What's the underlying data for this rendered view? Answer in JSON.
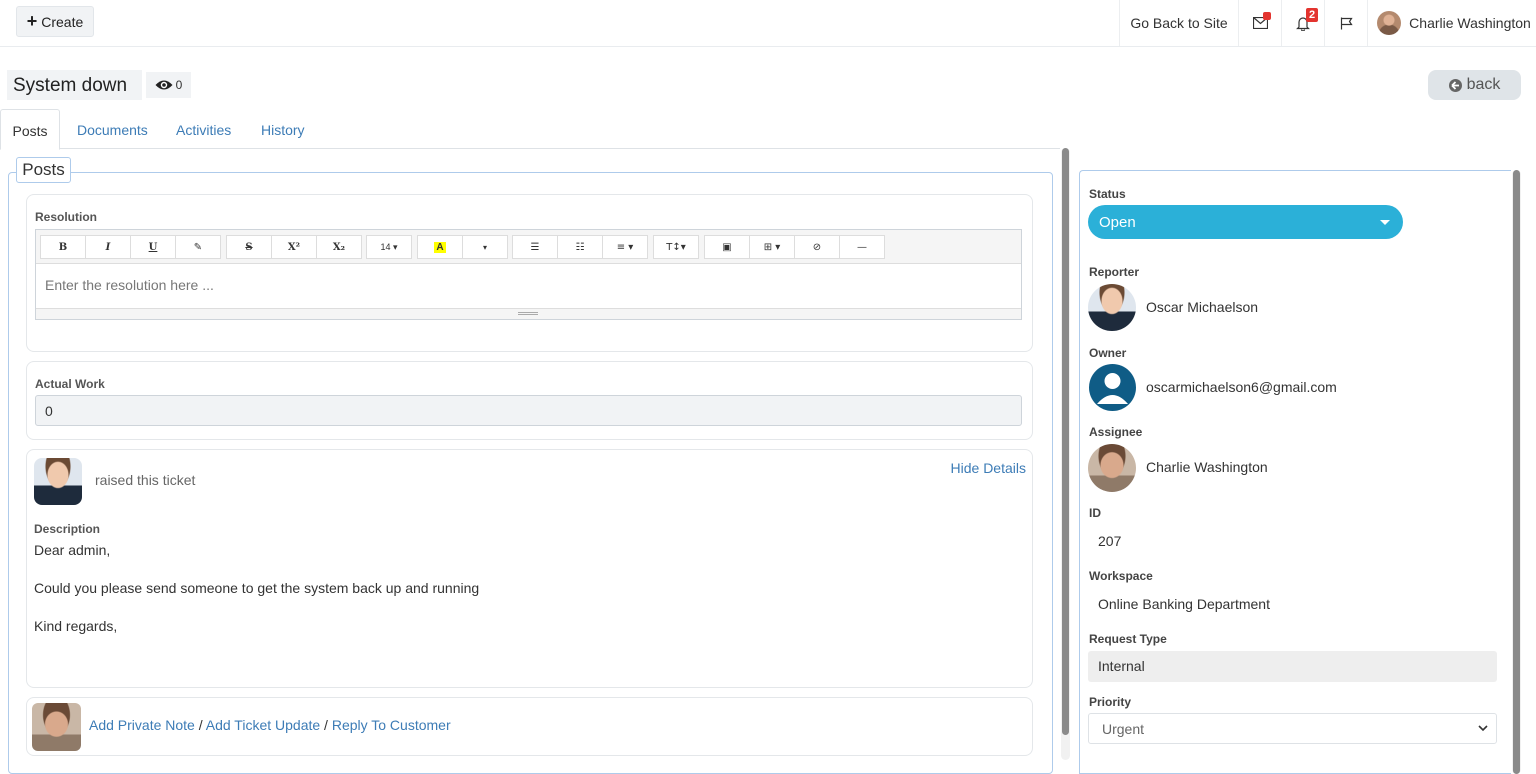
{
  "topbar": {
    "create_label": "Create",
    "go_back_label": "Go Back to Site",
    "notifications_count": "2",
    "user_name": "Charlie Washington"
  },
  "ticket": {
    "title": "System down",
    "views": "0",
    "back_label": "back"
  },
  "tabs": [
    {
      "label": "Posts"
    },
    {
      "label": "Documents"
    },
    {
      "label": "Activities"
    },
    {
      "label": "History"
    }
  ],
  "posts": {
    "legend": "Posts",
    "resolution_label": "Resolution",
    "resolution_placeholder": "Enter the resolution here ...",
    "toolbar": {
      "bold": "B",
      "italic": "I",
      "underline": "U",
      "clear": "✎",
      "strike": "S",
      "superscript": "X²",
      "subscript": "X₂",
      "fontsize": "14 ▾",
      "color": "A",
      "color_dropdown": "▾",
      "ul": "☰",
      "ol": "☷",
      "align": "≡ ▾",
      "style": "T↕▾",
      "picture": "▣",
      "table": "⊞ ▾",
      "link": "⊘",
      "hr": "—"
    },
    "actual_work_label": "Actual Work",
    "actual_work_value": "0",
    "raised_text": "raised this ticket",
    "hide_details": "Hide Details",
    "description_label": "Description",
    "description_lines": [
      "Dear admin,",
      "Could you please send someone to get the system back up and running",
      "Kind regards,"
    ],
    "actions": {
      "private_note": "Add Private Note",
      "ticket_update": "Add Ticket Update",
      "reply_customer": "Reply To Customer",
      "separator": "/"
    }
  },
  "details": {
    "status_label": "Status",
    "status_value": "Open",
    "reporter_label": "Reporter",
    "reporter_name": "Oscar Michaelson",
    "owner_label": "Owner",
    "owner_email": "oscarmichaelson6@gmail.com",
    "assignee_label": "Assignee",
    "assignee_name": "Charlie Washington",
    "id_label": "ID",
    "id_value": "207",
    "workspace_label": "Workspace",
    "workspace_value": "Online Banking Department",
    "request_type_label": "Request Type",
    "request_type_value": "Internal",
    "priority_label": "Priority",
    "priority_value": "Urgent"
  },
  "colors": {
    "accent": "#2bb0d8",
    "link": "#3d7cb6",
    "badge": "#e3342f"
  }
}
